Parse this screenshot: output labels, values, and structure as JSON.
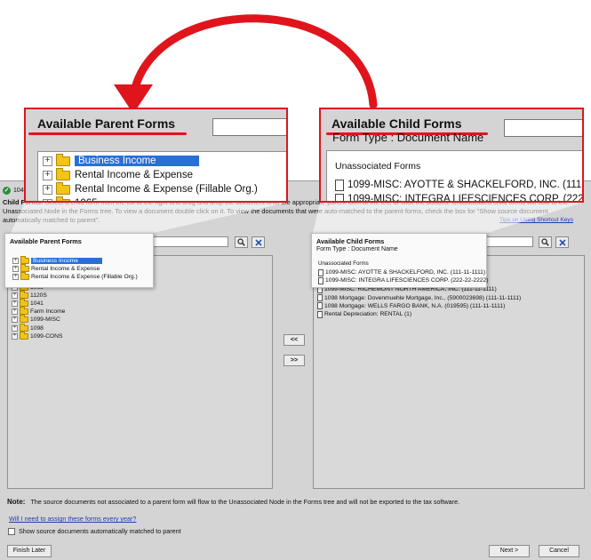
{
  "dialog": {
    "title": "1040",
    "instructions_bold": "Child Forms:",
    "instructions_line1": "Select a child form from the list at the right and drag and drop the document onto the appropriate parent form at the left, or click the buttons. Unassociated child forms will flow to",
    "instructions_line2": "the Unassociated Node in the Forms tree. To view a document double click on it. To view the documents that were auto-matched to the parent forms, check the box for \"Show source document",
    "instructions_line3": "automatically matched to parent\".",
    "tips_link": "Tips on Using Shortcut Keys"
  },
  "parent_panel": {
    "title": "Available Parent Forms",
    "items": [
      {
        "label": "Business Income",
        "selected": true
      },
      {
        "label": "Rental Income & Expense"
      },
      {
        "label": "Rental Income & Expense (Fillable Org.)"
      },
      {
        "label": "1065"
      },
      {
        "label": "1120S"
      },
      {
        "label": "1041"
      },
      {
        "label": "Farm Income"
      },
      {
        "label": "1099-MISC"
      },
      {
        "label": "1098"
      },
      {
        "label": "1099-CONS"
      }
    ]
  },
  "child_panel": {
    "title": "Available Child Forms",
    "subtitle": "Form Type : Document Name",
    "group_label": "Unassociated Forms",
    "items": [
      "1099-MISC: AYOTTE & SHACKELFORD, INC. (111-11-1111)",
      "1099-MISC: INTEGRA LIFESCIENCES CORP. (222-22-2222)",
      "1099-MISC: RICHEMONT NORTH AMERICA, INC. (111-11-1111)",
      "1098 Mortgage: Dovenmuehle Mortgage, Inc., (5900023698) (111-11-1111)",
      "1098 Mortgage: WELLS FARGO BANK, N.A. (019595) (111-11-1111)",
      "Rental Depreciation: RENTAL (1)"
    ]
  },
  "buttons": {
    "move_left": "<<",
    "move_right": ">>",
    "finish_later": "Finish Later",
    "next": "Next >",
    "cancel": "Cancel"
  },
  "footer": {
    "note_label": "Note:",
    "note_text": "The source documents not associated to a parent form will flow to the Unassociated Node in the Forms tree and will not be exported to the tax software.",
    "question_link": "Will I need to assign these forms every year?",
    "checkbox_label": "Show source documents automatically matched to parent"
  },
  "callouts": {
    "parent": {
      "title": "Available Parent Forms",
      "items": [
        "Business Income",
        "Rental Income & Expense",
        "Rental Income & Expense (Fillable Org.)",
        "1065"
      ]
    },
    "child": {
      "title": "Available Child Forms",
      "subtitle": "Form Type : Document Name",
      "group_label": "Unassociated Forms",
      "items": [
        "1099-MISC: AYOTTE & SHACKELFORD, INC. (111-11-1",
        "1099-MISC: INTEGRA LIFESCIENCES CORP. (222-22"
      ]
    }
  },
  "colors": {
    "highlight": "#e0141c",
    "selection": "#2a6fd6",
    "link": "#1a3fb0",
    "folder": "#f2c418"
  },
  "icons": [
    "search-icon",
    "clear-icon",
    "folder-icon",
    "document-icon",
    "expand-icon",
    "check-icon",
    "curved-arrow-icon"
  ]
}
